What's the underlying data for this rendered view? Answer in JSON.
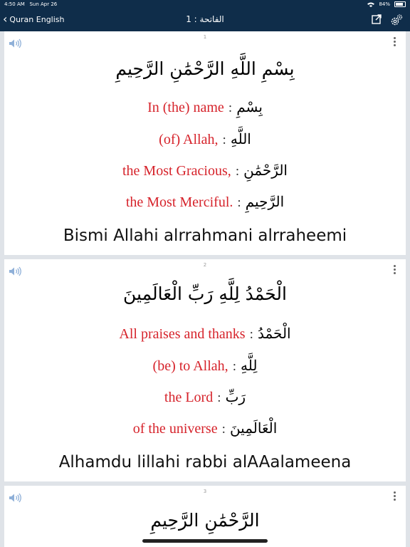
{
  "status": {
    "time": "4:50 AM",
    "date": "Sun Apr 26",
    "battery": "84%",
    "battery_level": 0.84
  },
  "nav": {
    "back_label": "Quran English",
    "title": "الفاتحة : 1"
  },
  "verses": [
    {
      "number": "1",
      "arabic": "بِسْمِ اللَّهِ الرَّحْمَٰنِ الرَّحِيمِ",
      "words": [
        {
          "en": "In (the) name",
          "ar": "بِسْمِ"
        },
        {
          "en": "(of) Allah,",
          "ar": "اللَّهِ"
        },
        {
          "en": "the Most Gracious,",
          "ar": "الرَّحْمَٰنِ"
        },
        {
          "en": "the Most Merciful.",
          "ar": "الرَّحِيمِ"
        }
      ],
      "transliteration": "Bismi Allahi alrrahmani alrraheemi"
    },
    {
      "number": "2",
      "arabic": "الْحَمْدُ لِلَّهِ رَبِّ الْعَالَمِينَ",
      "words": [
        {
          "en": "All praises and thanks",
          "ar": "الْحَمْدُ"
        },
        {
          "en": "(be) to Allah,",
          "ar": "لِلَّهِ"
        },
        {
          "en": "the Lord",
          "ar": "رَبِّ"
        },
        {
          "en": "of the universe",
          "ar": "الْعَالَمِينَ"
        }
      ],
      "transliteration": "Alhamdu lillahi rabbi alAAalameena"
    },
    {
      "number": "3",
      "arabic": "الرَّحْمَٰنِ الرَّحِيمِ"
    }
  ],
  "separator": ":"
}
